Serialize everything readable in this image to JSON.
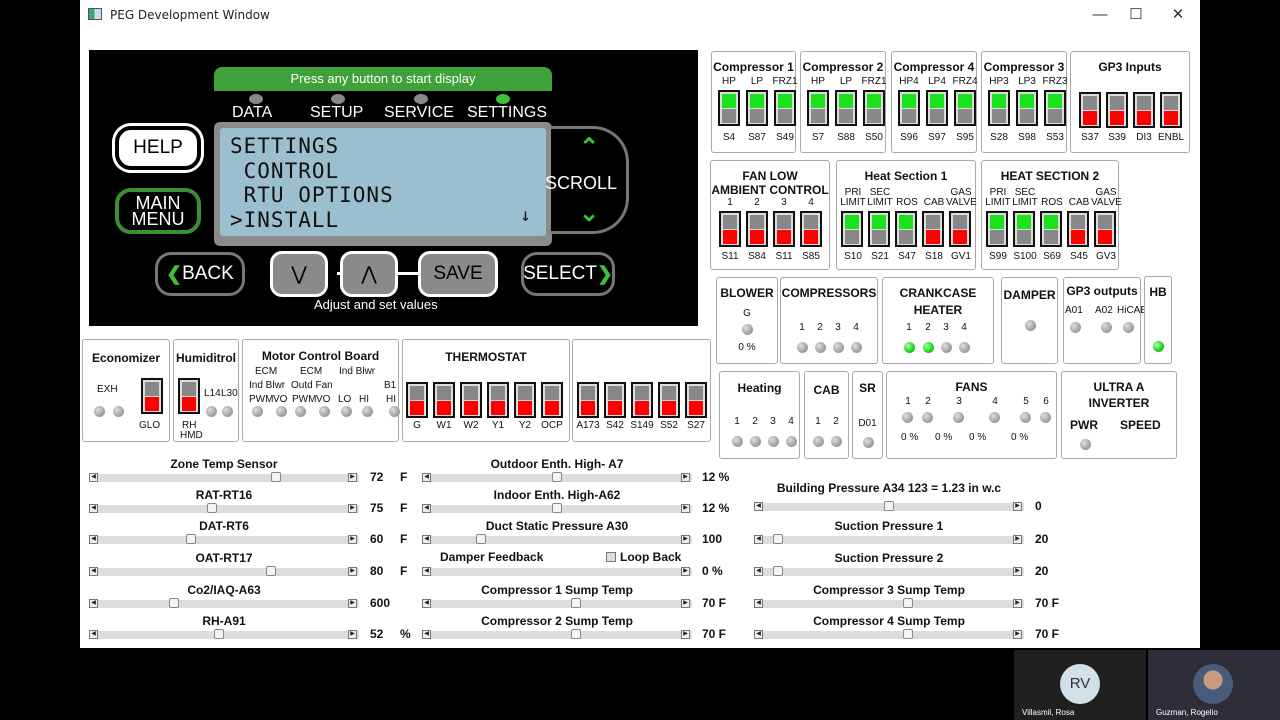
{
  "window": {
    "title": "PEG Development Window",
    "minimize": "—",
    "maximize": "☐",
    "close": "✕"
  },
  "display": {
    "banner": "Press any button to start display",
    "modes": [
      {
        "label": "DATA",
        "active": false
      },
      {
        "label": "SETUP",
        "active": false
      },
      {
        "label": "SERVICE",
        "active": false
      },
      {
        "label": "SETTINGS",
        "active": true
      }
    ],
    "lcd_lines": [
      "SETTINGS",
      " CONTROL",
      " RTU OPTIONS",
      ">INSTALL"
    ],
    "lcd_more_icon": "↓",
    "help": "HELP",
    "main_menu_1": "MAIN",
    "main_menu_2": "MENU",
    "scroll": "SCROLL",
    "scroll_up_icon": "︿",
    "scroll_down_icon": "﹀",
    "back": "BACK",
    "back_icon": "❮",
    "down_icon": "⋁",
    "up_icon": "⋀",
    "save": "SAVE",
    "select": "SELECT",
    "select_icon": "❯",
    "adjust": "Adjust and set values"
  },
  "compressors": [
    {
      "title": "Compressor 1",
      "labels": [
        "HP",
        "LP",
        "FRZ1"
      ],
      "ids": [
        "S4",
        "S87",
        "S49"
      ]
    },
    {
      "title": "Compressor 2",
      "labels": [
        "HP",
        "LP",
        "FRZ1"
      ],
      "ids": [
        "S7",
        "S88",
        "S50"
      ]
    },
    {
      "title": "Compressor 4",
      "labels": [
        "HP4",
        "LP4",
        "FRZ4"
      ],
      "ids": [
        "S96",
        "S97",
        "S95"
      ]
    },
    {
      "title": "Compressor 3",
      "labels": [
        "HP3",
        "LP3",
        "FRZ3"
      ],
      "ids": [
        "S28",
        "S98",
        "S53"
      ]
    }
  ],
  "gp3_inputs": {
    "title": "GP3 Inputs",
    "ids": [
      "S37",
      "S39",
      "DI3",
      "ENBL"
    ]
  },
  "fan_low": {
    "title1": "FAN LOW",
    "title2": "AMBIENT CONTROL",
    "nums": [
      "1",
      "2",
      "3",
      "4"
    ],
    "ids": [
      "S11",
      "S84",
      "S11",
      "S85"
    ]
  },
  "heat1": {
    "title": "Heat Section 1",
    "top": [
      "PRI",
      "SEC",
      "",
      "",
      "GAS"
    ],
    "bot": [
      "LIMIT",
      "LIMIT",
      "ROS",
      "CAB",
      "VALVE"
    ],
    "ids": [
      "S10",
      "S21",
      "S47",
      "S18",
      "GV1"
    ],
    "state": [
      "green",
      "green",
      "green",
      "red",
      "red"
    ]
  },
  "heat2": {
    "title": "HEAT SECTION 2",
    "top": [
      "PRI",
      "SEC",
      "",
      "",
      "GAS"
    ],
    "bot": [
      "LIMIT",
      "LIMIT",
      "ROS",
      "CAB",
      "VALVE"
    ],
    "ids": [
      "S99",
      "S100",
      "S69",
      "S45",
      "GV3"
    ],
    "state": [
      "green",
      "green",
      "green",
      "red",
      "red"
    ]
  },
  "blower": {
    "title": "BLOWER",
    "label": "G",
    "value": "0 %"
  },
  "compressors_out": {
    "title": "COMPRESSORS",
    "nums": [
      "1",
      "2",
      "3",
      "4"
    ]
  },
  "crankcase": {
    "title1": "CRANKCASE",
    "title2": "HEATER",
    "nums": [
      "1",
      "2",
      "3",
      "4"
    ],
    "on": [
      true,
      true,
      false,
      false
    ]
  },
  "damper": {
    "title": "DAMPER"
  },
  "gp3_outputs": {
    "title": "GP3 outputs",
    "labels": [
      "A01",
      "A02",
      "HiCAB"
    ]
  },
  "hb": {
    "title": "HB",
    "on": true
  },
  "heating": {
    "title": "Heating",
    "nums": [
      "1",
      "2",
      "3",
      "4"
    ]
  },
  "cab": {
    "title": "CAB",
    "nums": [
      "1",
      "2"
    ]
  },
  "sr": {
    "title": "SR",
    "label": "D01"
  },
  "fans": {
    "title": "FANS",
    "nums": [
      "1",
      "2",
      "3",
      "4",
      "5",
      "6"
    ],
    "values": [
      "0 %",
      "0 %",
      "0 %",
      "0 %"
    ]
  },
  "ultra": {
    "title1": "ULTRA A",
    "title2": "INVERTER",
    "pwr": "PWR",
    "speed": "SPEED"
  },
  "economizer": {
    "title": "Economizer",
    "exh": "EXH",
    "glo": "GLO"
  },
  "humiditrol": {
    "title": "Humiditrol",
    "l14": "L14",
    "l30": "L30",
    "rh": "RH",
    "hmd": "HMD"
  },
  "motor": {
    "title": "Motor Control Board",
    "ecm1": "ECM",
    "ind_blwr": "Ind Blwr",
    "ecm2": "ECM",
    "outd_fan": "Outd Fan",
    "ind_blwr2": "Ind Blwr",
    "b1": "B1",
    "labels": [
      "PWM",
      "VO",
      "PWM",
      "VO",
      "LO",
      "HI",
      "HI"
    ]
  },
  "thermostat": {
    "title": "THERMOSTAT",
    "ids": [
      "G",
      "W1",
      "W2",
      "Y1",
      "Y2",
      "OCP"
    ]
  },
  "extra_inputs": {
    "ids": [
      "A173",
      "S42",
      "S149",
      "S52",
      "S27"
    ]
  },
  "sliders_left": [
    {
      "title": "Zone Temp Sensor",
      "value": "72",
      "unit": "F",
      "pos": 0.72
    },
    {
      "title": "RAT-RT16",
      "value": "75",
      "unit": "F",
      "pos": 0.45
    },
    {
      "title": "DAT-RT6",
      "value": "60",
      "unit": "F",
      "pos": 0.36
    },
    {
      "title": "OAT-RT17",
      "value": "80",
      "unit": "F",
      "pos": 0.7
    },
    {
      "title": "Co2/IAQ-A63",
      "value": "600",
      "unit": "",
      "pos": 0.29
    },
    {
      "title": "RH-A91",
      "value": "52",
      "unit": "%",
      "pos": 0.48
    }
  ],
  "sliders_mid": [
    {
      "title": "Outdoor Enth. High- A7",
      "value": "12 %",
      "pos": 0.5
    },
    {
      "title": "Indoor Enth. High-A62",
      "value": "12 %",
      "pos": 0.5
    },
    {
      "title": "Duct Static Pressure A30",
      "value": "100",
      "pos": 0.18
    },
    {
      "title": "Damper Feedback",
      "value": "0 %",
      "pos": null
    },
    {
      "title": "Compressor 1 Sump Temp",
      "value": "70 F",
      "pos": 0.58
    },
    {
      "title": "Compressor 2 Sump Temp",
      "value": "70 F",
      "pos": 0.58
    }
  ],
  "loop_back": {
    "label": "Loop Back",
    "checked": false
  },
  "sliders_right": [
    {
      "title": "Building Pressure A34 123 = 1.23 in w.c",
      "value": "0",
      "pos": 0.5
    },
    {
      "title": "Suction Pressure 1",
      "value": "20",
      "pos": 0.03
    },
    {
      "title": "Suction Pressure 2",
      "value": "20",
      "pos": 0.03
    },
    {
      "title": "Compressor 3 Sump Temp",
      "value": "70 F",
      "pos": 0.58
    },
    {
      "title": "Compressor 4 Sump Temp",
      "value": "70 F",
      "pos": 0.58
    }
  ],
  "participants": [
    {
      "name": "Villasmil, Rosa",
      "initials": "RV"
    },
    {
      "name": "Guzman, Rogelio",
      "initials": ""
    }
  ]
}
